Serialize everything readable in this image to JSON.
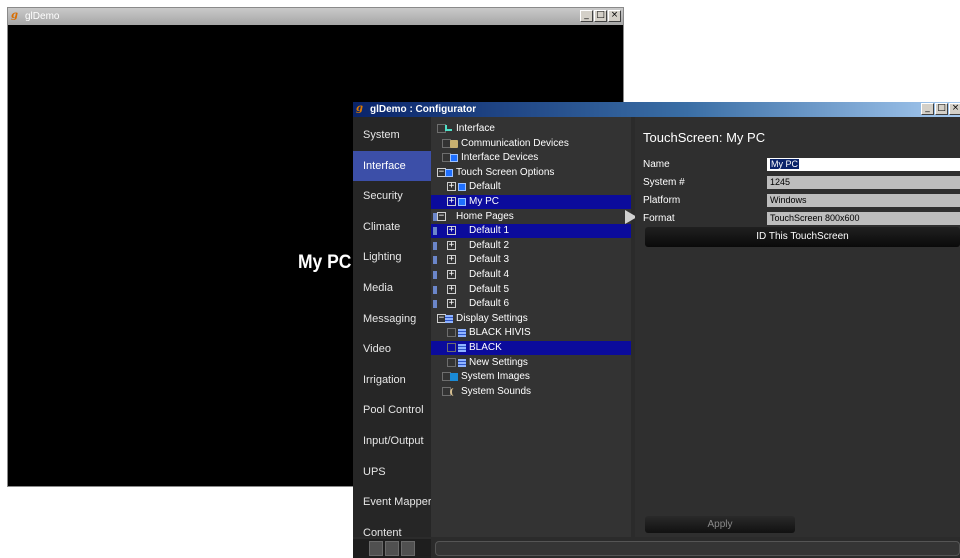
{
  "background_window": {
    "title": "glDemo",
    "content_label": "My PC"
  },
  "configurator": {
    "title": "glDemo : Configurator",
    "sidebar": {
      "items": [
        {
          "label": "System"
        },
        {
          "label": "Interface",
          "active": true
        },
        {
          "label": "Security"
        },
        {
          "label": "Climate"
        },
        {
          "label": "Lighting"
        },
        {
          "label": "Media"
        },
        {
          "label": "Messaging"
        },
        {
          "label": "Video"
        },
        {
          "label": "Irrigation"
        },
        {
          "label": "Pool Control"
        },
        {
          "label": "Input/Output"
        },
        {
          "label": "UPS"
        },
        {
          "label": "Event Mapper"
        },
        {
          "label": "Content"
        }
      ]
    },
    "tree": {
      "items": [
        {
          "label": "Interface",
          "icon": "interface-icon",
          "box": "check"
        },
        {
          "label": "Communication Devices",
          "icon": "satellite-icon",
          "box": "check"
        },
        {
          "label": "Interface Devices",
          "icon": "monitor-icon",
          "box": "check"
        },
        {
          "label": "Touch Screen Options",
          "icon": "monitor-icon",
          "box": "minus"
        },
        {
          "label": "Default",
          "icon": "monitor-icon",
          "box": "plus"
        },
        {
          "label": "My PC",
          "icon": "monitor-icon",
          "box": "plus",
          "selected": true
        },
        {
          "label": "Home Pages",
          "icon": "page-icon",
          "box": "minus"
        },
        {
          "label": "Default 1",
          "icon": "page-icon",
          "box": "plus",
          "selected": true
        },
        {
          "label": "Default 2",
          "icon": "page-icon",
          "box": "plus"
        },
        {
          "label": "Default 3",
          "icon": "page-icon",
          "box": "plus"
        },
        {
          "label": "Default 4",
          "icon": "page-icon",
          "box": "plus"
        },
        {
          "label": "Default 5",
          "icon": "page-icon",
          "box": "plus"
        },
        {
          "label": "Default 6",
          "icon": "page-icon",
          "box": "plus"
        },
        {
          "label": "Display Settings",
          "icon": "display-settings-icon",
          "box": "minus"
        },
        {
          "label": "BLACK HIVIS",
          "icon": "display-settings-icon",
          "box": "check"
        },
        {
          "label": "BLACK",
          "icon": "display-settings-icon",
          "box": "check",
          "selected": true
        },
        {
          "label": "New Settings",
          "icon": "display-settings-icon",
          "box": "check"
        },
        {
          "label": "System Images",
          "icon": "image-icon",
          "box": "check"
        },
        {
          "label": "System Sounds",
          "icon": "sound-icon",
          "box": "check"
        }
      ]
    },
    "panel": {
      "title": "TouchScreen: My PC",
      "name_label": "Name",
      "name_value": "My PC",
      "system_label": "System #",
      "system_value": "1245",
      "platform_label": "Platform",
      "platform_value": "Windows",
      "format_label": "Format",
      "format_value": "TouchScreen 800x600",
      "id_button": "ID This TouchScreen",
      "apply_button": "Apply"
    },
    "colors": {
      "selected_row": "#0b0b9c",
      "active_sidebar": "#3c4fa8",
      "title_bar": "#0a246a"
    }
  }
}
